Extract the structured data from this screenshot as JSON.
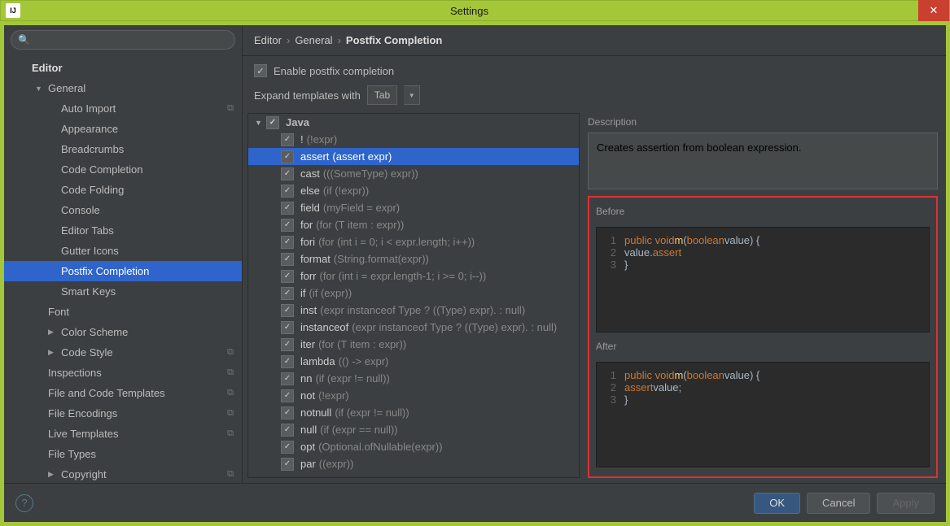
{
  "window": {
    "title": "Settings",
    "app_badge": "IJ"
  },
  "search": {
    "placeholder": ""
  },
  "sidebar": {
    "header": "Editor",
    "rows": [
      {
        "label": "General",
        "lvl": 1,
        "arrow": "▼"
      },
      {
        "label": "Auto Import",
        "lvl": 3,
        "cfg": true
      },
      {
        "label": "Appearance",
        "lvl": 3
      },
      {
        "label": "Breadcrumbs",
        "lvl": 3
      },
      {
        "label": "Code Completion",
        "lvl": 3
      },
      {
        "label": "Code Folding",
        "lvl": 3
      },
      {
        "label": "Console",
        "lvl": 3
      },
      {
        "label": "Editor Tabs",
        "lvl": 3
      },
      {
        "label": "Gutter Icons",
        "lvl": 3
      },
      {
        "label": "Postfix Completion",
        "lvl": 3,
        "selected": true
      },
      {
        "label": "Smart Keys",
        "lvl": 3
      },
      {
        "label": "Font",
        "lvl": 2
      },
      {
        "label": "Color Scheme",
        "lvl": 2,
        "arrow": "▶"
      },
      {
        "label": "Code Style",
        "lvl": 2,
        "arrow": "▶",
        "cfg": true
      },
      {
        "label": "Inspections",
        "lvl": 2,
        "cfg": true
      },
      {
        "label": "File and Code Templates",
        "lvl": 2,
        "cfg": true
      },
      {
        "label": "File Encodings",
        "lvl": 2,
        "cfg": true
      },
      {
        "label": "Live Templates",
        "lvl": 2,
        "cfg": true
      },
      {
        "label": "File Types",
        "lvl": 2
      },
      {
        "label": "Copyright",
        "lvl": 2,
        "arrow": "▶",
        "cfg": true
      }
    ]
  },
  "breadcrumb": {
    "p0": "Editor",
    "p1": "General",
    "p2": "Postfix Completion"
  },
  "options": {
    "enable_label": "Enable postfix completion",
    "expand_label": "Expand templates with",
    "expand_value": "Tab"
  },
  "templates": {
    "group": "Java",
    "items": [
      {
        "key": "!",
        "hint": "(!expr)"
      },
      {
        "key": "assert",
        "hint": "(assert expr)",
        "selected": true
      },
      {
        "key": "cast",
        "hint": "(((SomeType) expr))"
      },
      {
        "key": "else",
        "hint": "(if (!expr))"
      },
      {
        "key": "field",
        "hint": "(myField = expr)"
      },
      {
        "key": "for",
        "hint": "(for (T item : expr))"
      },
      {
        "key": "fori",
        "hint": "(for (int i = 0; i < expr.length; i++))"
      },
      {
        "key": "format",
        "hint": "(String.format(expr))"
      },
      {
        "key": "forr",
        "hint": "(for (int i = expr.length-1; i >= 0; i--))"
      },
      {
        "key": "if",
        "hint": "(if (expr))"
      },
      {
        "key": "inst",
        "hint": "(expr instanceof Type ? ((Type) expr). : null)"
      },
      {
        "key": "instanceof",
        "hint": "(expr instanceof Type ? ((Type) expr). : null)"
      },
      {
        "key": "iter",
        "hint": "(for (T item : expr))"
      },
      {
        "key": "lambda",
        "hint": "(() -> expr)"
      },
      {
        "key": "nn",
        "hint": "(if (expr != null))"
      },
      {
        "key": "not",
        "hint": "(!expr)"
      },
      {
        "key": "notnull",
        "hint": "(if (expr != null))"
      },
      {
        "key": "null",
        "hint": "(if (expr == null))"
      },
      {
        "key": "opt",
        "hint": "(Optional.ofNullable(expr))"
      },
      {
        "key": "par",
        "hint": "((expr))"
      }
    ]
  },
  "preview": {
    "desc_label": "Description",
    "description": "Creates assertion from boolean expression.",
    "before_label": "Before",
    "after_label": "After",
    "before": {
      "l1": {
        "kw": "public void",
        "fn": " m",
        "args": "(",
        "kw2": "boolean",
        "rest": " value)  {"
      },
      "l2": {
        "indent": "   ",
        "a": "value.",
        "b": "assert"
      },
      "l3": "}"
    },
    "after": {
      "l1": {
        "kw": "public void",
        "fn": " m",
        "args": "(",
        "kw2": "boolean",
        "rest": " value)  {"
      },
      "l2": {
        "indent": "   ",
        "a": "assert ",
        "b": "value;"
      },
      "l3": "}"
    }
  },
  "footer": {
    "ok": "OK",
    "cancel": "Cancel",
    "apply": "Apply"
  }
}
